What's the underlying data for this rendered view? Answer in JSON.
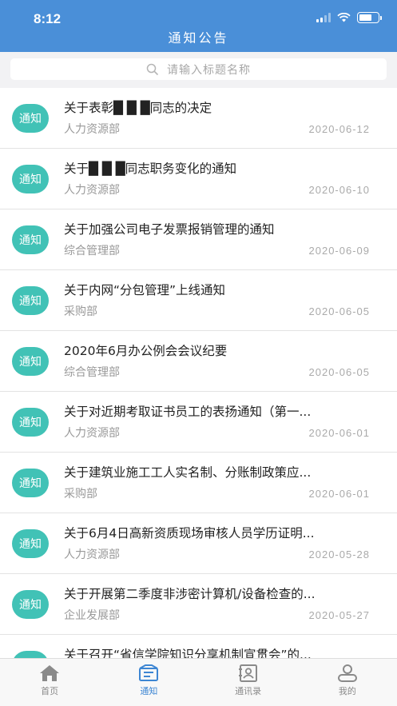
{
  "status_bar": {
    "time": "8:12"
  },
  "header": {
    "title": "通知公告"
  },
  "search": {
    "placeholder": "请输入标题名称"
  },
  "list": {
    "badge_label": "通知",
    "items": [
      {
        "title": "关于表彰█ █ █同志的决定",
        "department": "人力资源部",
        "date": "2020-06-12"
      },
      {
        "title": "关于█ █ █同志职务变化的通知",
        "department": "人力资源部",
        "date": "2020-06-10"
      },
      {
        "title": "关于加强公司电子发票报销管理的通知",
        "department": "综合管理部",
        "date": "2020-06-09"
      },
      {
        "title": "关于内网“分包管理”上线通知",
        "department": "采购部",
        "date": "2020-06-05"
      },
      {
        "title": "2020年6月办公例会会议纪要",
        "department": "综合管理部",
        "date": "2020-06-05"
      },
      {
        "title": "关于对近期考取证书员工的表扬通知（第一...",
        "department": "人力资源部",
        "date": "2020-06-01"
      },
      {
        "title": "关于建筑业施工工人实名制、分账制政策应...",
        "department": "采购部",
        "date": "2020-06-01"
      },
      {
        "title": "关于6月4日高新资质现场审核人员学历证明...",
        "department": "人力资源部",
        "date": "2020-05-28"
      },
      {
        "title": "关于开展第二季度非涉密计算机/设备检查的...",
        "department": "企业发展部",
        "date": "2020-05-27"
      },
      {
        "title": "关于召开“省信学院知识分享机制宣贯会”的...",
        "department": "",
        "date": ""
      }
    ]
  },
  "tabbar": {
    "tabs": [
      {
        "label": "首页",
        "icon": "home-icon"
      },
      {
        "label": "通知",
        "icon": "notice-icon"
      },
      {
        "label": "通讯录",
        "icon": "contacts-icon"
      },
      {
        "label": "我的",
        "icon": "profile-icon"
      }
    ],
    "active_index": 1
  },
  "colors": {
    "header": "#4a8fd8",
    "badge": "#41c2b6",
    "tab_active": "#3d86d3"
  }
}
